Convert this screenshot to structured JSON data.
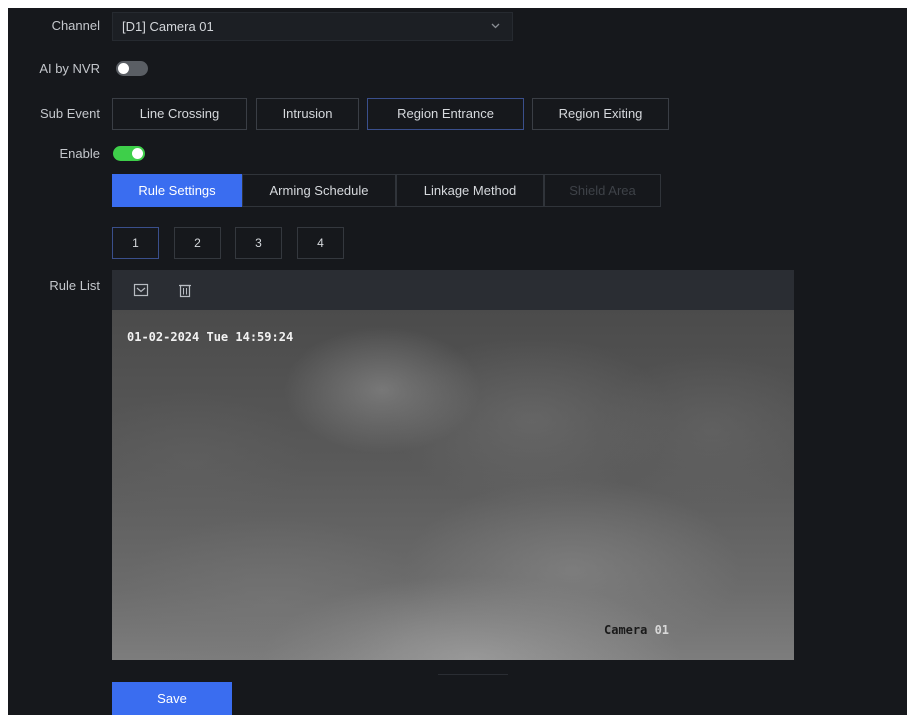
{
  "form": {
    "channel_label": "Channel",
    "channel_value": "[D1] Camera 01",
    "ai_by_nvr_label": "AI by NVR",
    "ai_by_nvr_enabled": false,
    "sub_event_label": "Sub Event",
    "sub_events": [
      "Line Crossing",
      "Intrusion",
      "Region Entrance",
      "Region Exiting"
    ],
    "sub_event_selected": "Region Entrance",
    "enable_label": "Enable",
    "enable_enabled": true
  },
  "tabs": [
    "Rule Settings",
    "Arming Schedule",
    "Linkage Method",
    "Shield Area"
  ],
  "tab_active": "Rule Settings",
  "tab_disabled": "Shield Area",
  "rules": {
    "numbers": [
      "1",
      "2",
      "3",
      "4"
    ],
    "selected": "1"
  },
  "rule_list": {
    "label": "Rule List",
    "draw_icon": "draw-region-icon",
    "delete_icon": "trash-icon"
  },
  "video": {
    "timestamp": "01-02-2024 Tue 14:59:24",
    "camera_name_prefix": "Camera ",
    "camera_name_number": "01"
  },
  "save_label": "Save",
  "colors": {
    "accent": "#3a6df0",
    "toggle_on": "#3ecf4a",
    "background": "#16181c"
  }
}
